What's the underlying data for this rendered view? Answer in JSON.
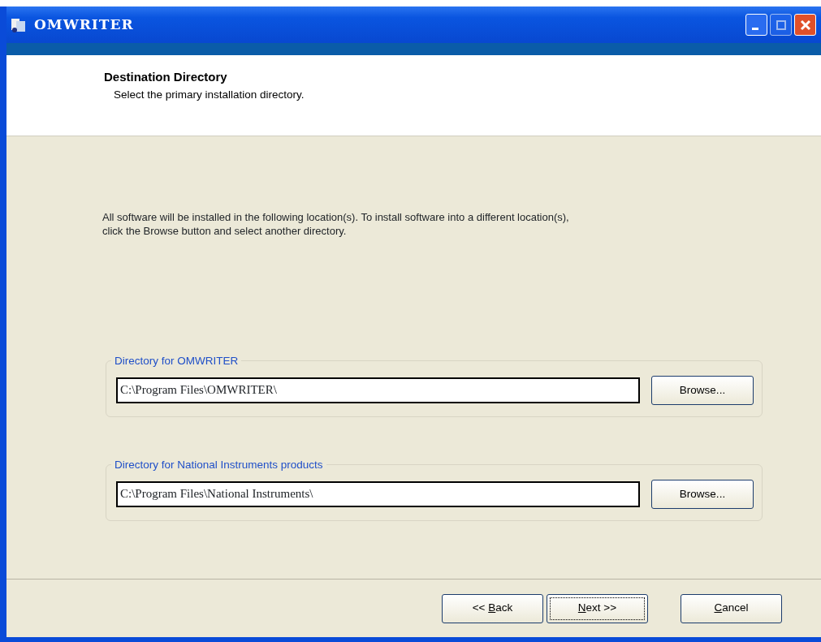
{
  "window": {
    "title": "OMWRITER"
  },
  "header": {
    "title": "Destination Directory",
    "subtitle": "Select the primary installation directory."
  },
  "intro": "All software will be installed in the following location(s). To install software into a different location(s), click the Browse button and select another directory.",
  "directories": [
    {
      "legend": "Directory for OMWRITER",
      "path": "C:\\Program Files\\OMWRITER\\",
      "button": "Browse..."
    },
    {
      "legend": "Directory for National Instruments products",
      "path": "C:\\Program Files\\National Instruments\\",
      "button": "Browse..."
    }
  ],
  "buttons": [
    {
      "before": "<< ",
      "access_key": "B",
      "after": "ack",
      "focused": false
    },
    {
      "access_key": "N",
      "after": "ext >>",
      "focused": true
    },
    {
      "access_key": "C",
      "after": "ancel",
      "focused": false
    }
  ]
}
